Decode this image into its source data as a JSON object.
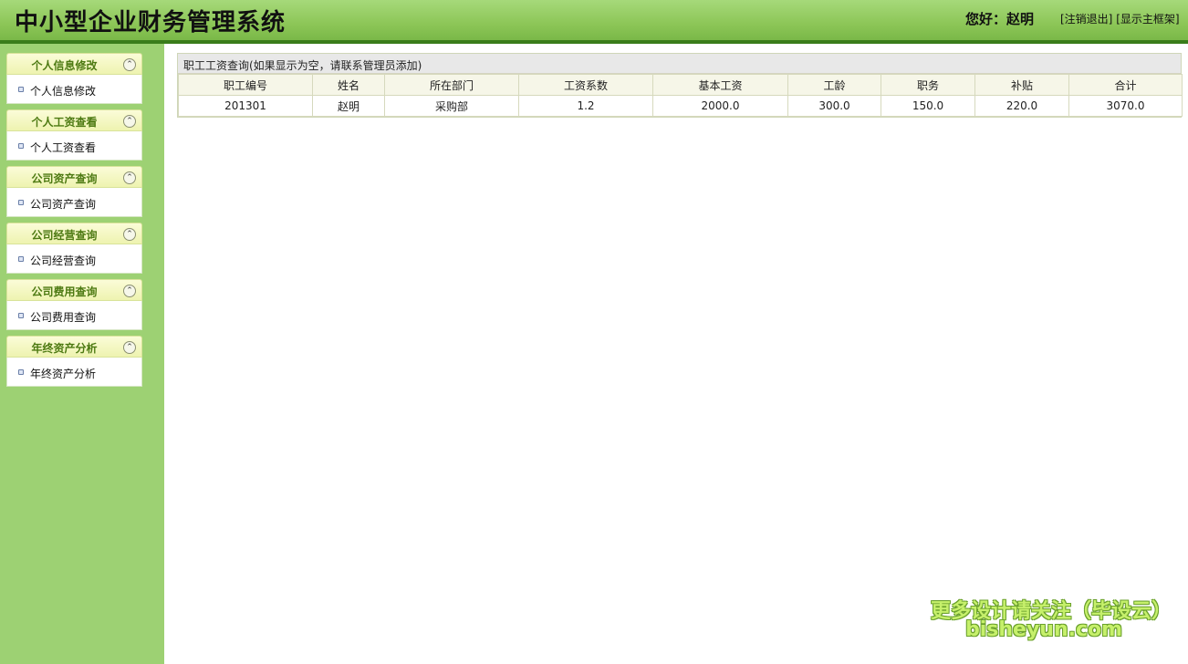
{
  "header": {
    "title": "中小型企业财务管理系统",
    "greeting": "您好：赵明",
    "logout_label": "[注销退出]",
    "show_frame_label": "[显示主框架]"
  },
  "sidebar": {
    "groups": [
      {
        "title": "个人信息修改",
        "item": "个人信息修改"
      },
      {
        "title": "个人工资查看",
        "item": "个人工资查看"
      },
      {
        "title": "公司资产查询",
        "item": "公司资产查询"
      },
      {
        "title": "公司经营查询",
        "item": "公司经营查询"
      },
      {
        "title": "公司费用查询",
        "item": "公司费用查询"
      },
      {
        "title": "年终资产分析",
        "item": "年终资产分析"
      }
    ],
    "collapse_glyph": "⌃"
  },
  "main": {
    "panel_title": "职工工资查询(如果显示为空，请联系管理员添加)",
    "columns": [
      "职工编号",
      "姓名",
      "所在部门",
      "工资系数",
      "基本工资",
      "工龄",
      "职务",
      "补贴",
      "合计"
    ],
    "rows": [
      [
        "201301",
        "赵明",
        "采购部",
        "1.2",
        "2000.0",
        "300.0",
        "150.0",
        "220.0",
        "3070.0"
      ]
    ]
  },
  "watermark": {
    "line1": "更多设计请关注（毕设云）",
    "line2": "bisheyun.com"
  },
  "colors": {
    "header_green": "#8cc657",
    "header_border": "#3a7d1b",
    "sidebar_bg": "#9dd173",
    "group_title": "#4d7a12"
  }
}
